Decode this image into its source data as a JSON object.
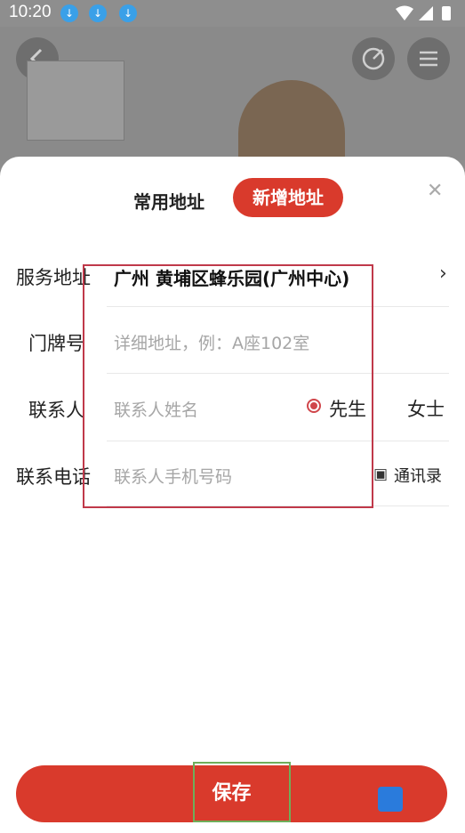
{
  "status_bar": {
    "time": "10:20",
    "notification_icons": [
      "download-icon",
      "download-icon",
      "download-icon"
    ]
  },
  "tabs": {
    "common": "常用地址",
    "new": "新增地址"
  },
  "form": {
    "service_address": {
      "label": "服务地址",
      "value": "广州 黄埔区蜂乐园(广州中心)"
    },
    "door_number": {
      "label": "门牌号",
      "placeholder": "详细地址，例：A座102室"
    },
    "contact": {
      "label": "联系人",
      "placeholder": "联系人姓名",
      "options": [
        "先生",
        "女士"
      ],
      "selected": "先生"
    },
    "phone": {
      "label": "联系电话",
      "placeholder": "联系人手机号码",
      "contacts_link": "通讯录"
    }
  },
  "actions": {
    "save": "保存"
  },
  "colors": {
    "accent": "#d93a2c",
    "annotation_red": "#c0394a",
    "annotation_green": "#6fae5a"
  }
}
